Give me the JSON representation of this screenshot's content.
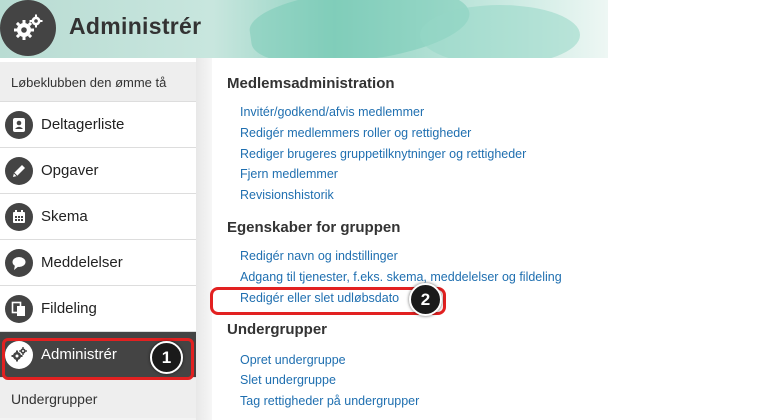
{
  "header": {
    "title": "Administrér",
    "logo_icon": "gears-icon"
  },
  "sidebar": {
    "group_label": "Løbeklubben den ømme tå",
    "items": [
      {
        "label": "Deltagerliste",
        "icon": "contact-card-icon"
      },
      {
        "label": "Opgaver",
        "icon": "pencil-icon"
      },
      {
        "label": "Skema",
        "icon": "calendar-icon"
      },
      {
        "label": "Meddelelser",
        "icon": "speech-bubble-icon"
      },
      {
        "label": "Fildeling",
        "icon": "copy-files-icon"
      },
      {
        "label": "Administrér",
        "icon": "gears-icon",
        "active": true
      }
    ],
    "footer_label": "Undergrupper"
  },
  "content": {
    "sections": [
      {
        "title": "Medlemsadministration",
        "links": [
          "Invitér/godkend/afvis medlemmer",
          "Redigér medlemmers roller og rettigheder",
          "Rediger brugeres gruppetilknytninger og rettigheder",
          "Fjern medlemmer",
          "Revisionshistorik"
        ]
      },
      {
        "title": "Egenskaber for gruppen",
        "links": [
          "Redigér navn og indstillinger",
          "Adgang til tjenester, f.eks. skema, meddelelser og fildeling",
          "Redigér eller slet udløbsdato"
        ]
      },
      {
        "title": "Undergrupper",
        "links": [
          "Opret undergruppe",
          "Slet undergruppe",
          "Tag rettigheder på undergrupper"
        ]
      }
    ]
  },
  "callouts": {
    "one": "1",
    "two": "2"
  },
  "colors": {
    "highlight": "#e22121",
    "link": "#1f6fb0",
    "active_bg": "#444444"
  }
}
